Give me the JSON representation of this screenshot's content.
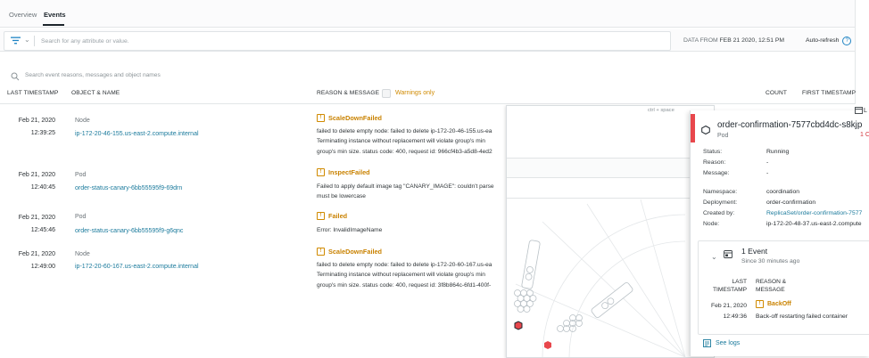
{
  "tabs": [
    {
      "label": "Overview",
      "active": false
    },
    {
      "label": "Events",
      "active": true
    }
  ],
  "filter": {
    "placeholder": "Search for any attribute or value.",
    "date_from_label": "DATA FROM",
    "date_from_value": "FEB 21 2020, 12:51 PM",
    "auto_refresh": "Auto-refresh",
    "help_glyph": "?"
  },
  "events_search": {
    "placeholder": "Search event reasons, messages and object names"
  },
  "columns": {
    "last_timestamp": "LAST TIMESTAMP",
    "object_name": "OBJECT & NAME",
    "reason_message": "REASON & MESSAGE",
    "warnings_only": "Warnings only",
    "count": "COUNT",
    "first_timestamp": "FIRST TIMESTAMP"
  },
  "rows": [
    {
      "date": "Feb 21, 2020",
      "time": "12:39:25",
      "kind": "Node",
      "name": "ip-172-20-46-155.us-east-2.compute.internal",
      "reason": "ScaleDownFailed",
      "message_lines": [
        "failed to delete empty node: failed to delete ip-172-20-46-155.us-ea",
        "Terminating instance without replacement will violate group's min",
        "group's min size. status code: 400, request id: 966cf4b3-a5d8-4ed2"
      ]
    },
    {
      "date": "Feb 21, 2020",
      "time": "12:40:45",
      "kind": "Pod",
      "name": "order-status-canary-6bb55595f9-69drn",
      "reason": "InspectFailed",
      "message_lines": [
        "Failed to apply default image tag \"CANARY_IMAGE\": couldn't parse",
        "must be lowercase"
      ]
    },
    {
      "date": "Feb 21, 2020",
      "time": "12:45:46",
      "kind": "Pod",
      "name": "order-status-canary-6bb55595f9-g6qnc",
      "reason": "Failed",
      "message_lines": [
        "Error: InvalidImageName"
      ]
    },
    {
      "date": "Feb 21, 2020",
      "time": "12:49:00",
      "kind": "Node",
      "name": "ip-172-20-60-167.us-east-2.compute.internal",
      "reason": "ScaleDownFailed",
      "message_lines": [
        "failed to delete empty node: failed to delete ip-172-20-60-167.us-ea",
        "Terminating instance without replacement will violate group's min",
        "group's min size. status code: 400, request id: 3f8b864c-6fd1-400f-"
      ]
    }
  ],
  "map": {
    "shortcut": "ctrl + space"
  },
  "detail": {
    "title": "order-confirmation-7577cbd4dc-s8kjp",
    "kind": "Pod",
    "count_fragment": "1 C",
    "fields": [
      {
        "key": "Status:",
        "value": "Running",
        "link": false
      },
      {
        "key": "Reason:",
        "value": "-",
        "link": false
      },
      {
        "key": "Message:",
        "value": "-",
        "link": false
      },
      {
        "key": "Namespace:",
        "value": "coordination",
        "link": false
      },
      {
        "key": "Deployment:",
        "value": "order-confirmation",
        "link": false
      },
      {
        "key": "Created by:",
        "value": "ReplicaSet/order-confirmation-7577",
        "link": true
      },
      {
        "key": "Node:",
        "value": "ip-172-20-48-37.us-east-2.compute",
        "link": false
      }
    ],
    "events": {
      "title": "1 Event",
      "since": "Since 30 minutes ago",
      "hdr_last": "LAST",
      "hdr_timestamp": "TIMESTAMP",
      "hdr_reason": "REASON &",
      "hdr_message": "MESSAGE",
      "date": "Feb 21, 2020",
      "time": "12:49:36",
      "reason": "BackOff",
      "message": "Back-off restarting failed container"
    },
    "see_logs": "See logs"
  },
  "corner_label": "L",
  "colors": {
    "warning": "#d08a00",
    "link": "#1a7a9c",
    "critical": "#e8474c"
  }
}
